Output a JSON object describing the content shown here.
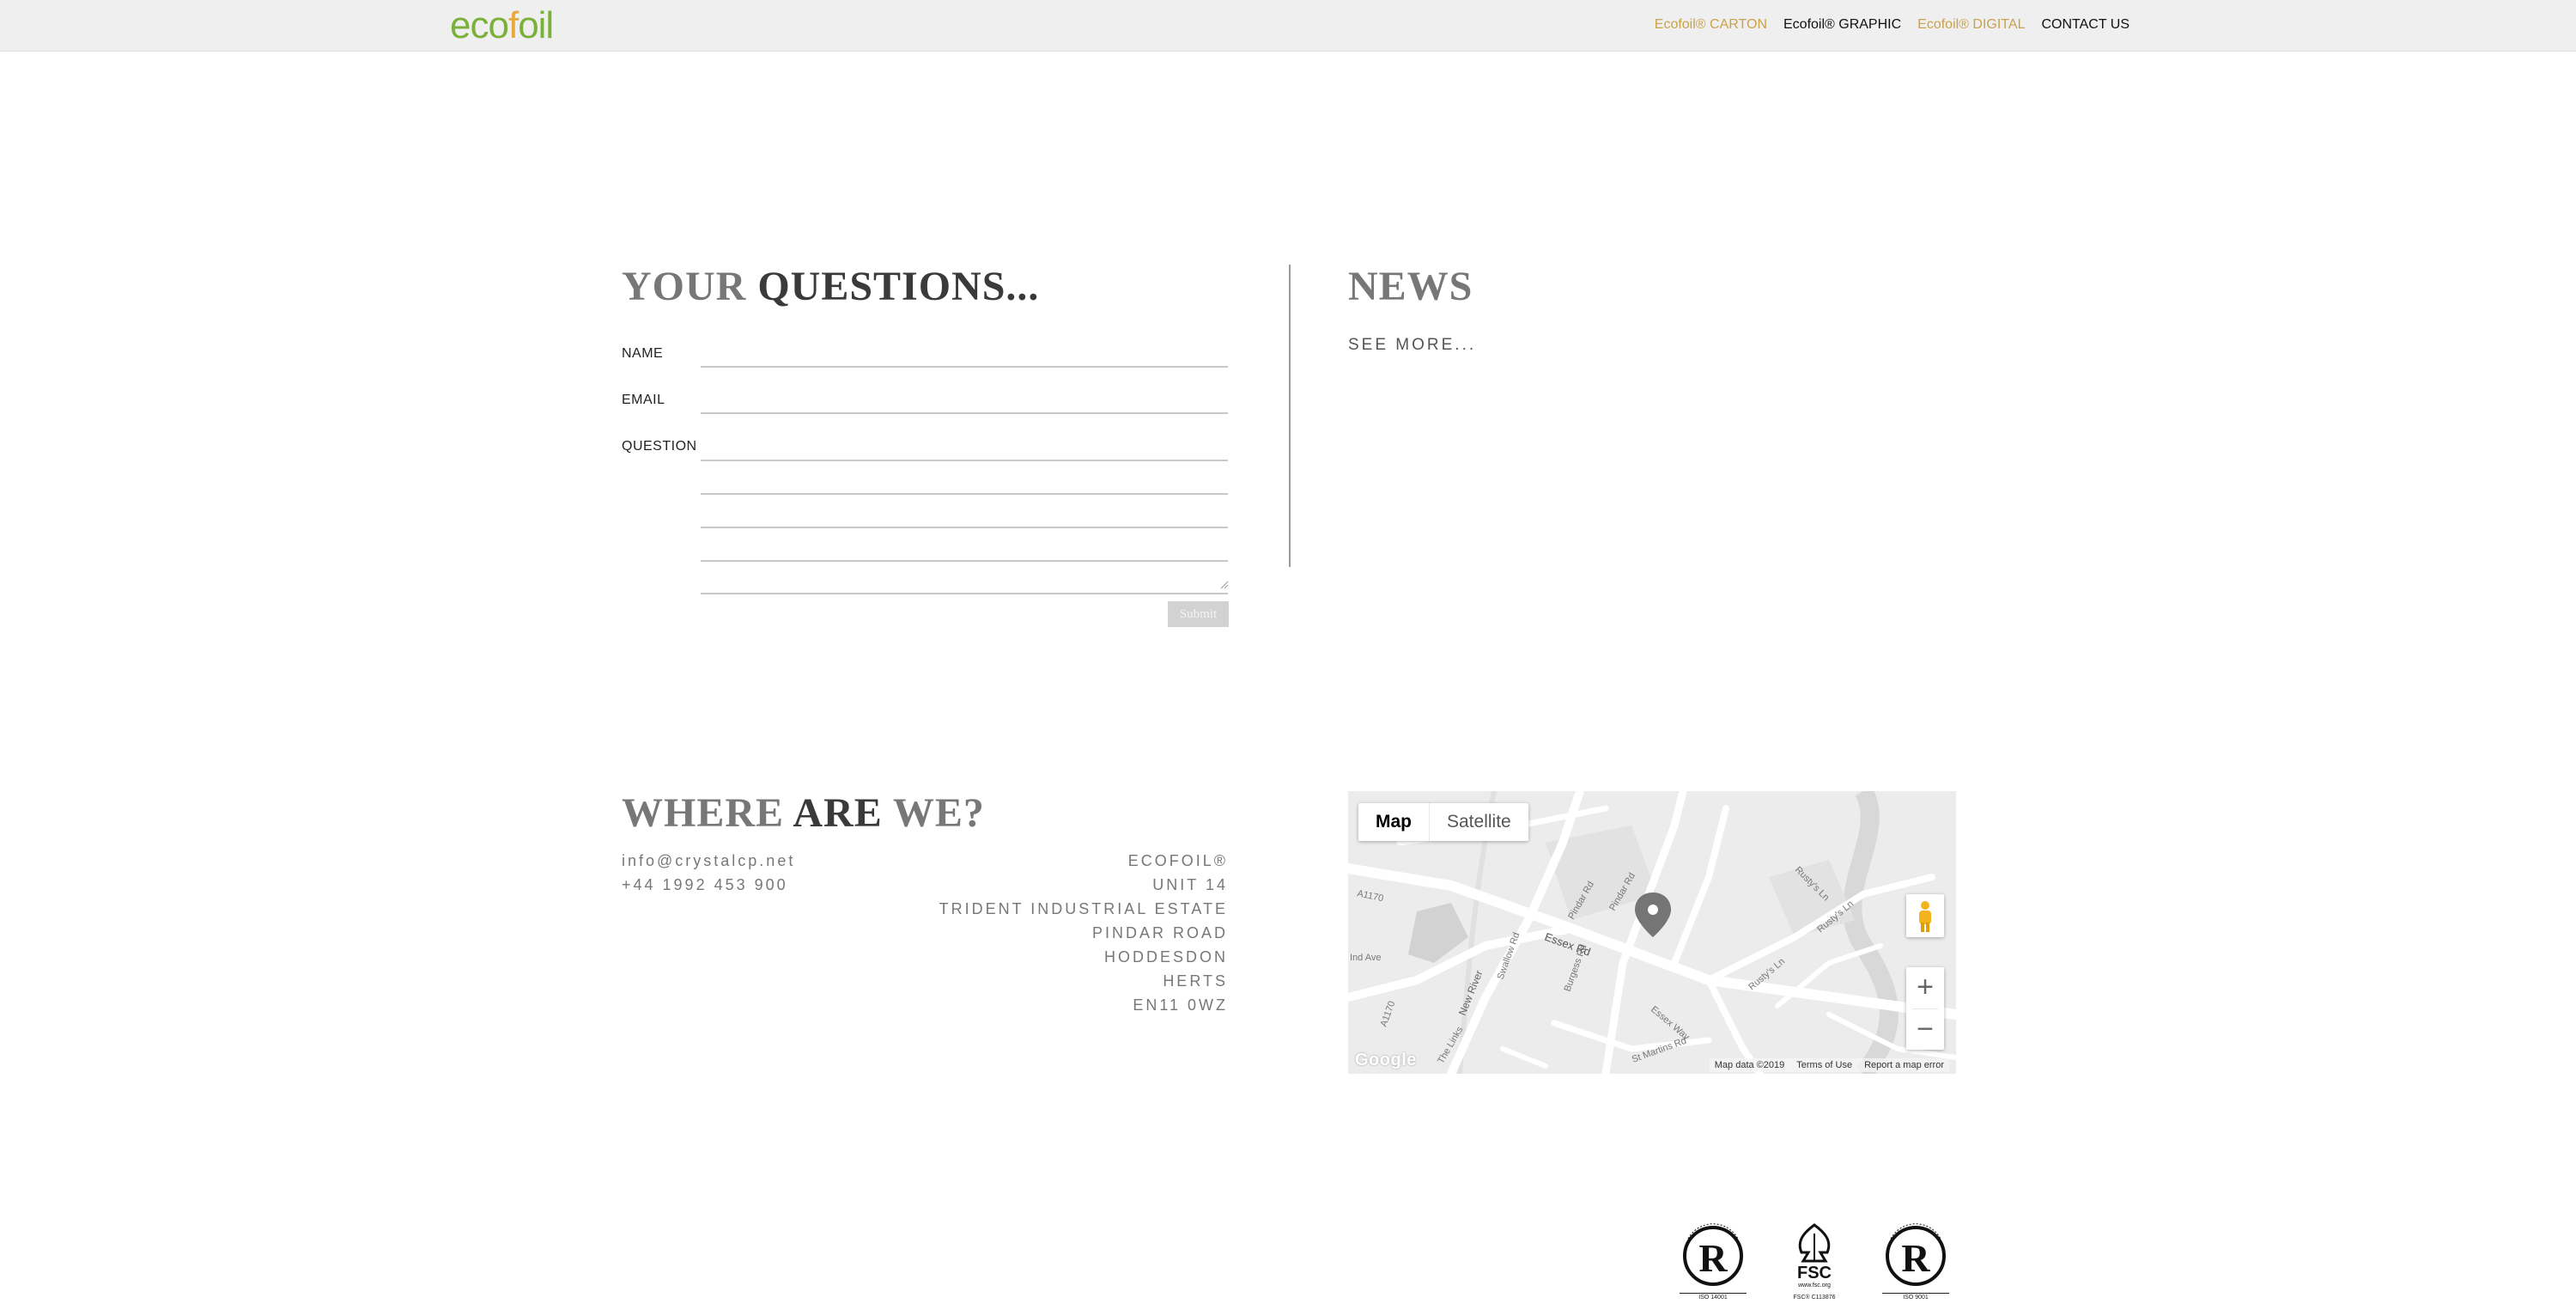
{
  "header": {
    "logo_part1": "eco",
    "logo_part2": "f",
    "logo_part3": "oil",
    "nav": [
      {
        "label": "Ecofoil® CARTON",
        "color": "#c9a24a"
      },
      {
        "label": "Ecofoil® GRAPHIC",
        "color": "#111111"
      },
      {
        "label": "Ecofoil® DIGITAL",
        "color": "#c9a24a"
      },
      {
        "label": "CONTACT US",
        "color": "#111111"
      }
    ]
  },
  "questions": {
    "title_light": "YOUR",
    "title_dark": "QUESTIONS...",
    "name_label": "NAME",
    "email_label": "EMAIL",
    "question_label": "QUESTION",
    "name_value": "",
    "email_value": "",
    "submit_label": "Submit"
  },
  "news": {
    "title": "NEWS",
    "see_more": "SEE MORE..."
  },
  "where": {
    "title_light1": "WHERE",
    "title_dark": "ARE",
    "title_light2": "WE?",
    "email": "info@crystalcp.net",
    "phone": "+44 1992 453 900",
    "address": [
      "ECOFOIL®",
      "UNIT 14",
      "TRIDENT INDUSTRIAL ESTATE",
      "PINDAR ROAD",
      "HODDESDON",
      "HERTS",
      "EN11 0WZ"
    ]
  },
  "map": {
    "type_map": "Map",
    "type_satellite": "Satellite",
    "zoom_in": "+",
    "zoom_out": "−",
    "google_label": "Google",
    "attribution": "Map data ©2019",
    "terms": "Terms of Use",
    "report": "Report a map error",
    "street_labels": [
      "A1170",
      "A1170",
      "Essex Rd",
      "Pindar Rd",
      "Pindar Rd",
      "New River",
      "Essex Way",
      "St Martins Rd",
      "Rusty's Ln",
      "Rusty's Ln",
      "Rusty's Ln",
      "Swallow Rd",
      "Burgess Rd",
      "Ind Ave",
      "The Links"
    ],
    "marker_icon": "location-pin-icon",
    "pegman_icon": "street-view-pegman-icon"
  },
  "certs": [
    {
      "caption": "ISO 14001",
      "icon": "registered-quality-iso14001-icon"
    },
    {
      "caption": "FSC® C113876",
      "icon": "fsc-tree-icon",
      "mark": "FSC",
      "sub": "www.fsc.org"
    },
    {
      "caption": "ISO 9001",
      "icon": "registered-quality-iso9001-icon"
    }
  ],
  "colors": {
    "gold": "#c9a24a",
    "logo_green": "#7bb13a",
    "logo_orange": "#e8a83c",
    "heading_grey": "#777777"
  }
}
